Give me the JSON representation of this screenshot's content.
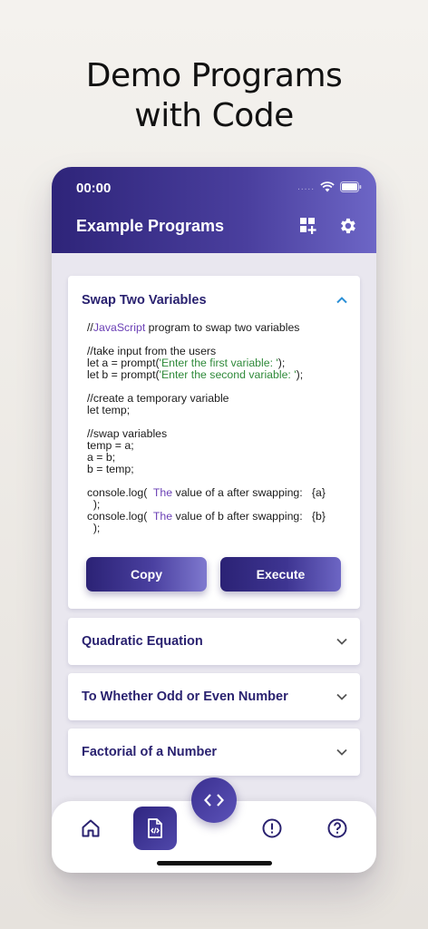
{
  "headline": {
    "line1": "Demo Programs",
    "line2": "with Code"
  },
  "status": {
    "time": "00:00",
    "dots": "....."
  },
  "appbar": {
    "title": "Example Programs",
    "icons": [
      "add-widget-icon",
      "gear-icon"
    ]
  },
  "cards": [
    {
      "title": "Swap Two Variables",
      "expanded": true,
      "code": {
        "l1_prefix": "//",
        "l1_kw": "JavaScript",
        "l1_rest": " program to swap two variables",
        "l2": "//take input from the users",
        "l3_prefix": "let a = prompt(",
        "l3_str": "'Enter the first variable: '",
        "l3_suffix": ");",
        "l4_prefix": "let b = prompt(",
        "l4_str": "'Enter the second variable: '",
        "l4_suffix": ");",
        "l5": "//create a temporary variable",
        "l6": "let temp;",
        "l7": "//swap variables",
        "l8": "temp = a;",
        "l9": "a = b;",
        "l10": "b = temp;",
        "l11_prefix": "console.log(  ",
        "l11_kw": "The",
        "l11_rest": " value of a after swapping:   {a}",
        "l12": "  );",
        "l13_prefix": "console.log(  ",
        "l13_kw": "The",
        "l13_rest": " value of b after swapping:   {b}",
        "l14": "  );"
      },
      "copy_label": "Copy",
      "execute_label": "Execute"
    },
    {
      "title": "Quadratic Equation",
      "expanded": false
    },
    {
      "title": "To Whether Odd or Even Number",
      "expanded": false
    },
    {
      "title": "Factorial of a Number",
      "expanded": false
    }
  ],
  "bottom_nav": {
    "fab_icon": "code-icon",
    "items": [
      "home-icon",
      "code-file-icon",
      "alert-circle-icon",
      "help-circle-icon"
    ],
    "active": "code-file-icon"
  },
  "colors": {
    "primary": "#2e2479",
    "accent": "#5b52b8",
    "keyword": "#6a3fb5",
    "string": "#2f8a3a"
  }
}
